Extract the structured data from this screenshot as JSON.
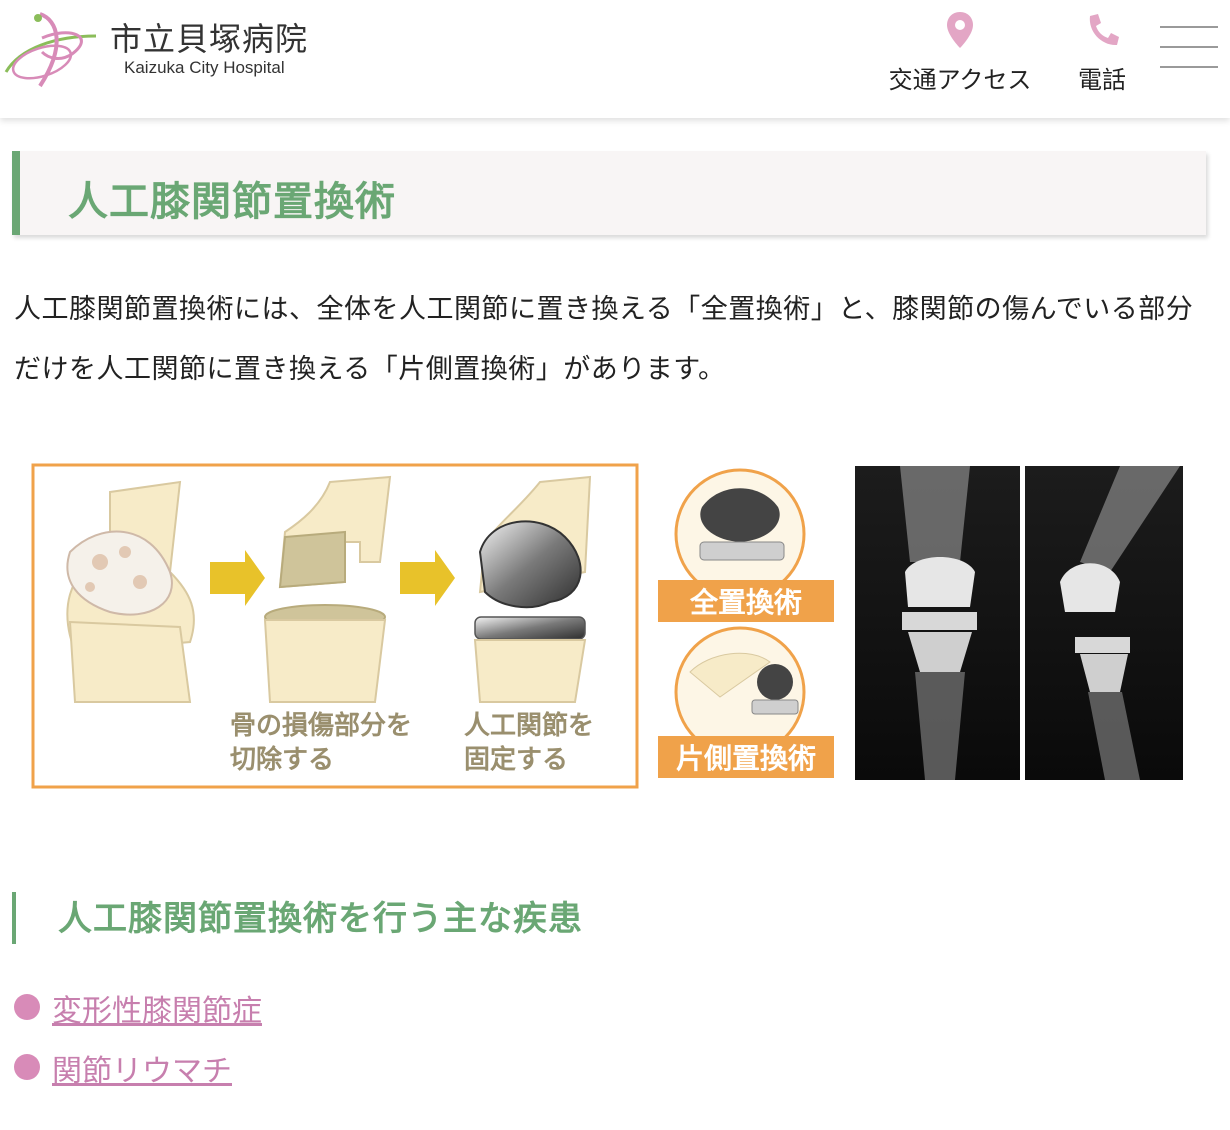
{
  "header": {
    "brand_jp": "市立貝塚病院",
    "brand_en": "Kaizuka City Hospital",
    "nav": {
      "access_label": "交通アクセス",
      "phone_label": "電話"
    }
  },
  "main": {
    "title": "人工膝関節置換術",
    "intro": "人工膝関節置換術には、全体を人工関節に置き換える「全置換術」と、膝関節の傷んでいる部分だけを人工関節に置き換える「片側置換術」があります。",
    "figure": {
      "step1_caption_l1": "骨の損傷部分を",
      "step1_caption_l2": "切除する",
      "step2_caption_l1": "人工関節を",
      "step2_caption_l2": "固定する",
      "label_total": "全置換術",
      "label_partial": "片側置換術"
    },
    "diseases": {
      "heading": "人工膝関節置換術を行う主な疾患",
      "items": [
        "変形性膝関節症",
        "関節リウマチ"
      ]
    }
  },
  "colors": {
    "accent_green": "#6aa774",
    "accent_pink": "#d88bb8",
    "figure_orange": "#f0a24a",
    "arrow_yellow": "#e8c22a"
  }
}
